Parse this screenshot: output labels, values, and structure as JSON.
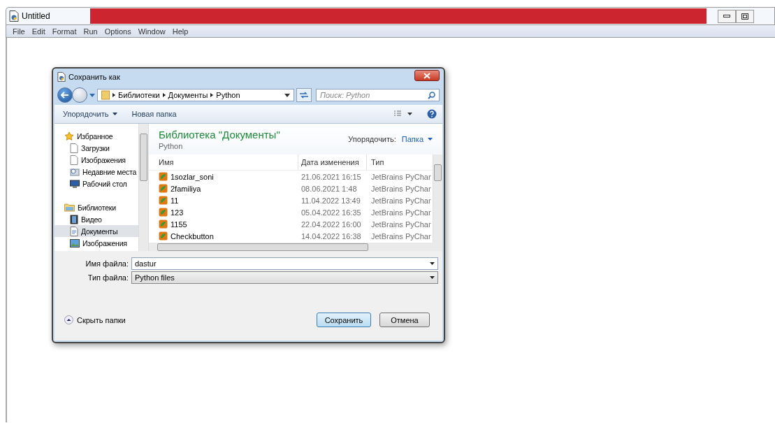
{
  "window": {
    "title": "Untitled"
  },
  "menu": [
    "File",
    "Edit",
    "Format",
    "Run",
    "Options",
    "Window",
    "Help"
  ],
  "dialog": {
    "title": "Сохранить как",
    "breadcrumb": [
      "Библиотеки",
      "Документы",
      "Python"
    ],
    "search": {
      "placeholder": "Поиск: Python"
    },
    "toolbar": {
      "organize": "Упорядочить",
      "new_folder": "Новая папка"
    },
    "nav": [
      {
        "label": "Избранное",
        "kind": "star",
        "selected": false,
        "children": [
          {
            "label": "Загрузки",
            "kind": "page",
            "selected": false
          },
          {
            "label": "Изображения",
            "kind": "page",
            "selected": false
          },
          {
            "label": "Недавние места",
            "kind": "recent",
            "selected": false
          },
          {
            "label": "Рабочий стол",
            "kind": "desktop",
            "selected": false
          }
        ]
      },
      {
        "label": "Библиотеки",
        "kind": "library",
        "selected": false,
        "children": [
          {
            "label": "Видео",
            "kind": "video",
            "selected": false
          },
          {
            "label": "Документы",
            "kind": "document",
            "selected": true
          },
          {
            "label": "Изображения",
            "kind": "picture",
            "selected": false
          }
        ]
      }
    ],
    "library": {
      "title": "Библиотека \"Документы\"",
      "subtitle": "Python",
      "arrange_label": "Упорядочить:",
      "arrange_value": "Папка"
    },
    "columns": [
      "Имя",
      "Дата изменения",
      "Тип"
    ],
    "rows": [
      {
        "name": "1sozlar_soni",
        "date": "21.06.2021 16:15",
        "type": "JetBrains PyChar"
      },
      {
        "name": "2familiya",
        "date": "08.06.2021 1:48",
        "type": "JetBrains PyChar"
      },
      {
        "name": "11",
        "date": "11.04.2022 13:49",
        "type": "JetBrains PyChar"
      },
      {
        "name": "123",
        "date": "05.04.2022 16:35",
        "type": "JetBrains PyChar"
      },
      {
        "name": "1155",
        "date": "22.04.2022 16:00",
        "type": "JetBrains PyChar"
      },
      {
        "name": "Checkbutton",
        "date": "14.04.2022 16:38",
        "type": "JetBrains PyChar"
      }
    ],
    "filename": {
      "label": "Имя файла:",
      "value": "dastur"
    },
    "filetype": {
      "label": "Тип файла:",
      "value": "Python files"
    },
    "hide_folders": "Скрыть папки",
    "buttons": [
      {
        "label": "Сохранить",
        "default": true
      },
      {
        "label": "Отмена",
        "default": false
      }
    ]
  }
}
